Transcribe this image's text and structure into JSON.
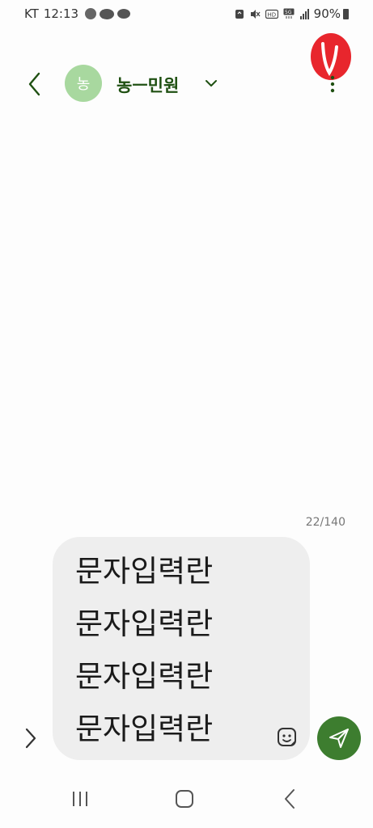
{
  "status_bar": {
    "carrier": "KT",
    "time": "12:13",
    "battery": "90%",
    "icons": [
      "screen-record-icon",
      "kakaotalk-icon",
      "chat-icon",
      "sync-icon",
      "mute-icon",
      "hd-icon",
      "5g-icon",
      "signal-icon",
      "battery-icon"
    ]
  },
  "header": {
    "avatar_initial": "농",
    "contact_name": "농ㅡ민원",
    "back_icon": "chevron-left-icon",
    "dropdown_icon": "chevron-down-icon",
    "more_icon": "more-vertical-icon"
  },
  "annotation": {
    "color": "#e8262d"
  },
  "composer": {
    "char_count": "22/140",
    "text": "문자입력란\n문자입력란\n문자입력란\n문자입력란",
    "sticker_icon": "sticker-icon",
    "send_icon": "send-icon",
    "expand_icon": "chevron-right-icon"
  },
  "nav_bar": {
    "icons": [
      "recents-icon",
      "home-icon",
      "back-icon"
    ]
  },
  "colors": {
    "accent": "#3d7d2f",
    "avatar_bg": "#a8d89f",
    "name_color": "#1f5012",
    "composer_bg": "#eeeeee"
  }
}
